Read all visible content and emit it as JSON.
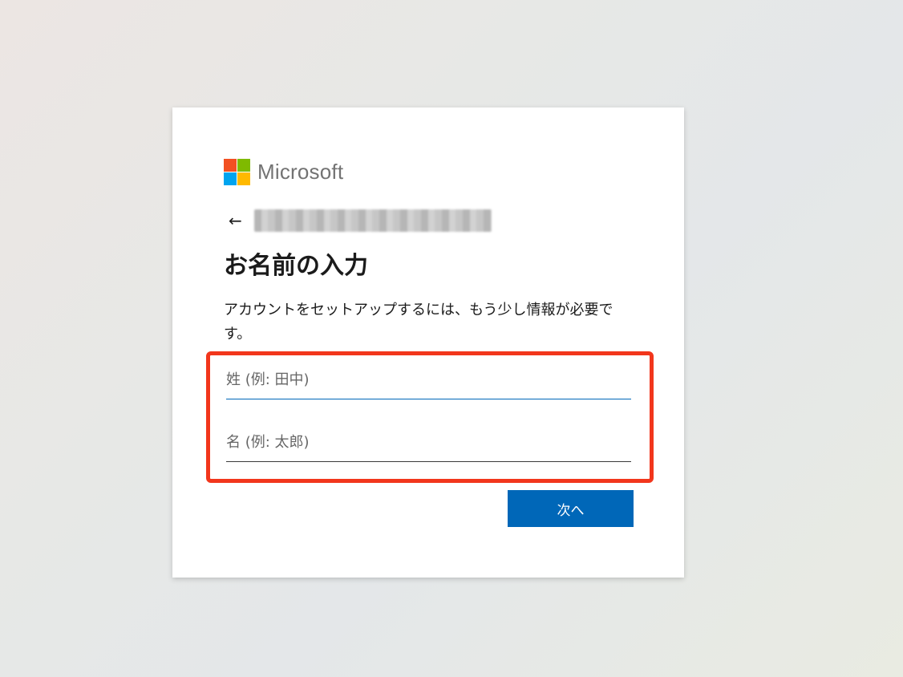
{
  "brand": {
    "name": "Microsoft",
    "logo_colors": [
      "#f25022",
      "#7fba00",
      "#00a4ef",
      "#ffb900"
    ]
  },
  "nav": {
    "back_icon": "arrow-left-icon"
  },
  "page": {
    "title": "お名前の入力",
    "description": "アカウントをセットアップするには、もう少し情報が必要です。"
  },
  "form": {
    "last_name": {
      "value": "",
      "placeholder": "姓 (例: 田中)"
    },
    "first_name": {
      "value": "",
      "placeholder": "名 (例: 太郎)"
    },
    "next_label": "次へ"
  },
  "colors": {
    "accent": "#0067b8",
    "highlight": "#f2361c"
  }
}
